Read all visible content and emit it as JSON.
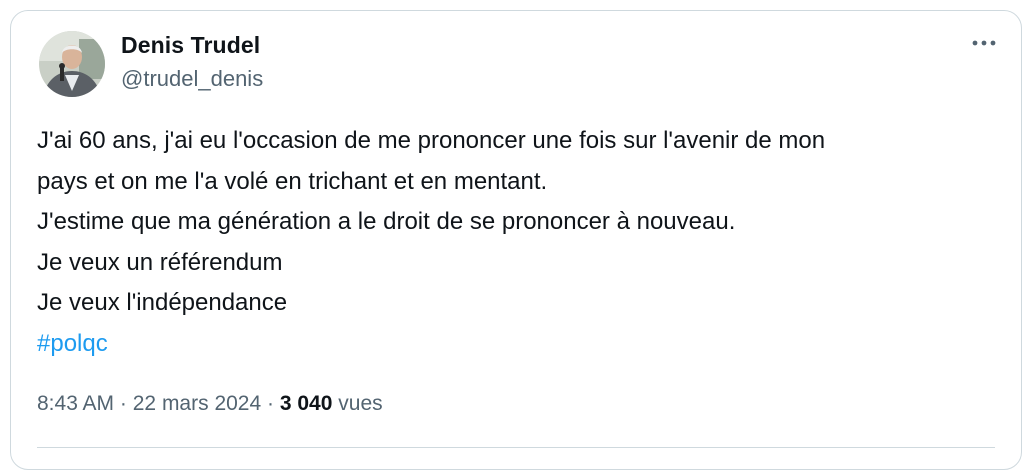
{
  "author": {
    "name": "Denis Trudel",
    "handle": "@trudel_denis"
  },
  "tweet": {
    "lines": [
      "J'ai 60 ans, j'ai eu l'occasion de me prononcer une fois sur l'avenir de mon",
      "pays et on me l'a volé en trichant et en mentant.",
      "J'estime que ma génération a le droit de se prononcer à nouveau.",
      "Je veux un référendum",
      "Je veux l'indépendance"
    ],
    "hashtag": "#polqc"
  },
  "meta": {
    "time": "8:43 AM",
    "separator": "·",
    "date": "22 mars 2024",
    "views_count": "3 040",
    "views_label": "vues"
  },
  "icons": {
    "more": "more-horizontal-icon"
  },
  "colors": {
    "link": "#1d9bf0",
    "secondary_text": "#536471",
    "border": "#cfd9de"
  }
}
